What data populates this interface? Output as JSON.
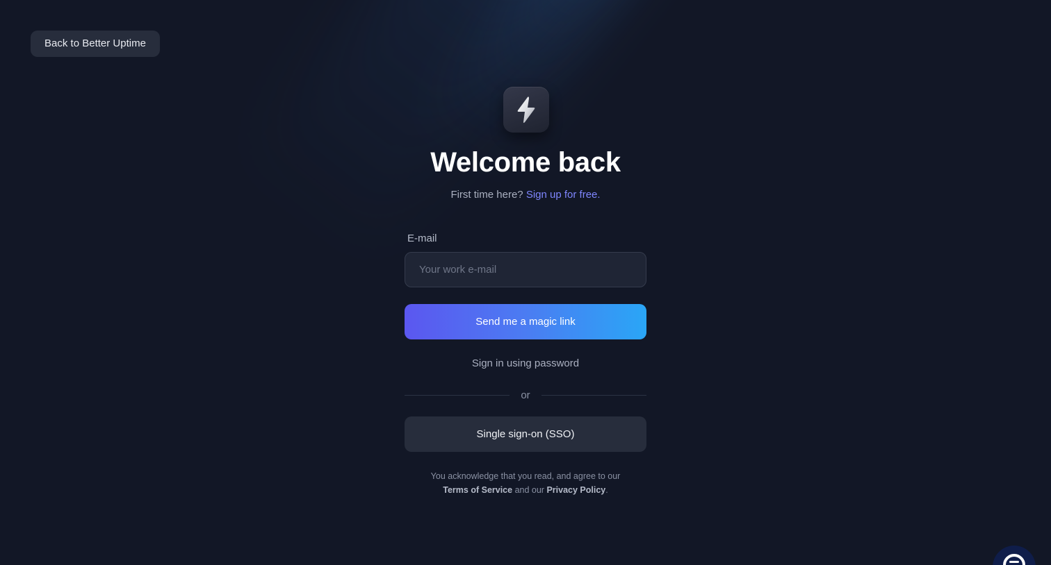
{
  "back_button": {
    "label": "Back to Better Uptime"
  },
  "logo": {
    "icon": "lightning-bolt-icon"
  },
  "heading": {
    "title": "Welcome back"
  },
  "signup": {
    "prompt": "First time here?",
    "link_label": "Sign up for free."
  },
  "email": {
    "label": "E-mail",
    "placeholder": "Your work e-mail",
    "value": ""
  },
  "magic_link_button": {
    "label": "Send me a magic link"
  },
  "password_link": {
    "label": "Sign in using password"
  },
  "divider": {
    "label": "or"
  },
  "sso_button": {
    "label": "Single sign-on (SSO)"
  },
  "legal": {
    "line1": "You acknowledge that you read, and agree to our",
    "terms_label": "Terms of Service",
    "connector": "and our",
    "privacy_label": "Privacy Policy",
    "end": "."
  },
  "chat_widget": {
    "icon": "chat-icon"
  },
  "colors": {
    "background": "#121726",
    "accent_link": "#7f86ff",
    "gradient_start": "#5b57f0",
    "gradient_end": "#2aa6f6",
    "button_secondary": "#272d3c"
  }
}
